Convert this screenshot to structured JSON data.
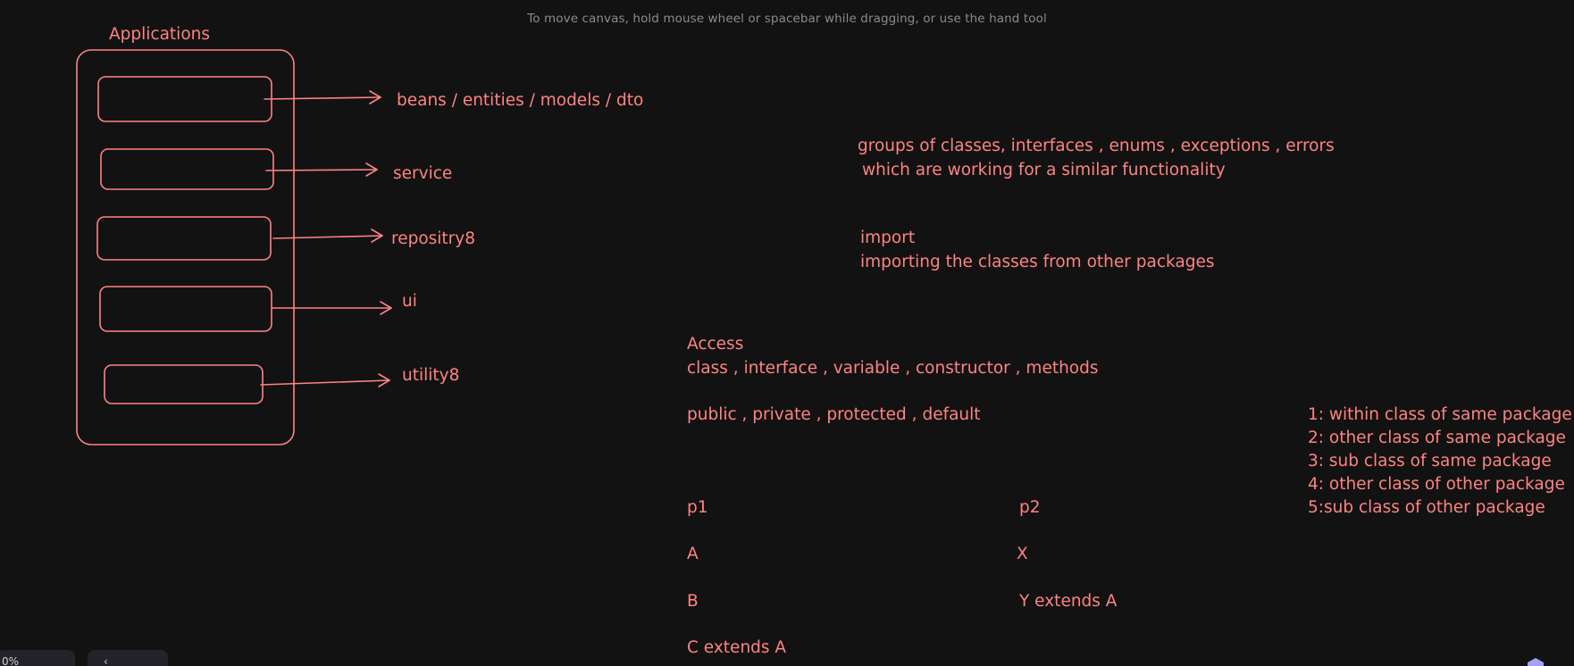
{
  "hint": "To move canvas, hold mouse wheel or spacebar while dragging, or use the hand tool",
  "diagram": {
    "container_label": "Applications",
    "layers": [
      {
        "label": "beans / entities / models / dto"
      },
      {
        "label": "service"
      },
      {
        "label": "repositry8"
      },
      {
        "label": "ui"
      },
      {
        "label": "utility8"
      }
    ]
  },
  "notes": {
    "packages_line1": "groups of classes, interfaces , enums , exceptions , errors",
    "packages_line2": "which are working for a  similar functionality",
    "import_title": "import",
    "import_desc": "importing the classes from other packages",
    "access_title": "Access",
    "access_items": "class , interface , variable , constructor , methods",
    "modifiers": "public  , private , protected , default",
    "scopes": [
      "1: within class of same package",
      "2: other class of same package",
      "3: sub class of same package",
      "4: other class of other package",
      "5:sub class of other package"
    ],
    "p1": "p1",
    "p2": "p2",
    "a": "A",
    "x": "X",
    "b": "B",
    "y_extends": "Y extends A",
    "c_extends": "C extends A"
  },
  "footer": {
    "zoom_partial": "0%",
    "nav_partial": "‹"
  },
  "colors": {
    "stroke": "#ff8383",
    "background": "#121212"
  }
}
